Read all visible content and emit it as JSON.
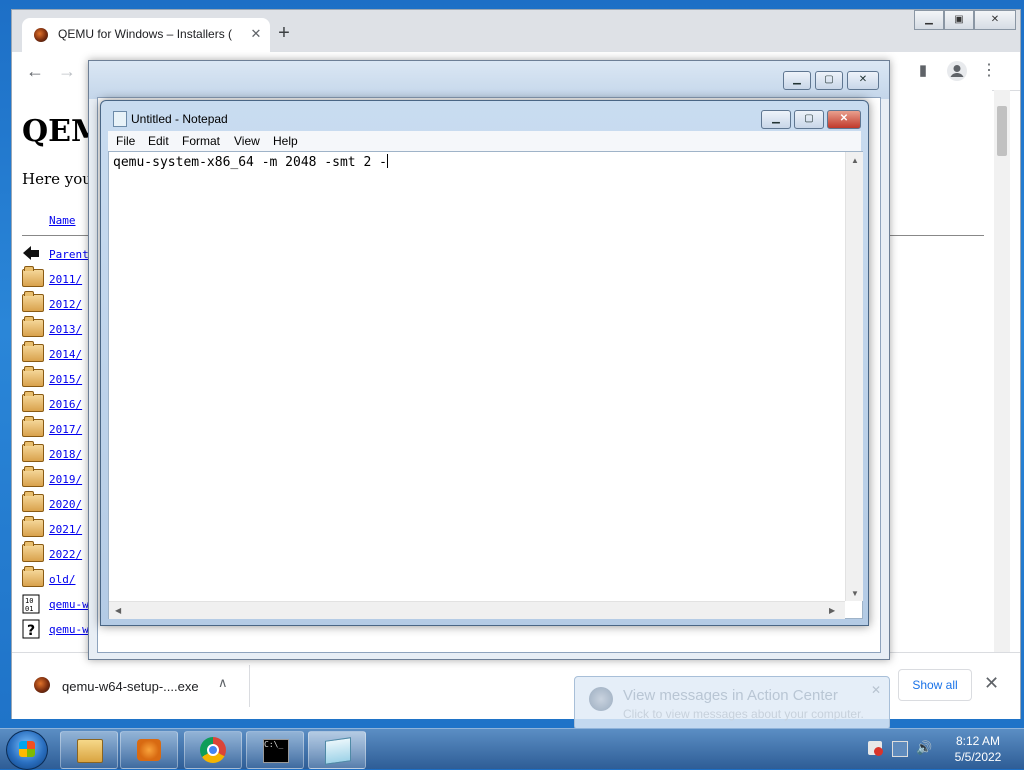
{
  "browser": {
    "tab_title": "QEMU for Windows – Installers (",
    "new_tab": "+",
    "tab_close": "✕",
    "back": "←",
    "forward": "→"
  },
  "page": {
    "heading": "QEM",
    "intro": "Here you g",
    "column_name": "Name",
    "rows": [
      {
        "label": "Parent",
        "icon": "back-arrow-icon"
      },
      {
        "label": "2011/",
        "icon": "folder-icon"
      },
      {
        "label": "2012/",
        "icon": "folder-icon"
      },
      {
        "label": "2013/",
        "icon": "folder-icon"
      },
      {
        "label": "2014/",
        "icon": "folder-icon"
      },
      {
        "label": "2015/",
        "icon": "folder-icon"
      },
      {
        "label": "2016/",
        "icon": "folder-icon"
      },
      {
        "label": "2017/",
        "icon": "folder-icon"
      },
      {
        "label": "2018/",
        "icon": "folder-icon"
      },
      {
        "label": "2019/",
        "icon": "folder-icon"
      },
      {
        "label": "2020/",
        "icon": "folder-icon"
      },
      {
        "label": "2021/",
        "icon": "folder-icon"
      },
      {
        "label": "2022/",
        "icon": "folder-icon"
      },
      {
        "label": "old/",
        "icon": "folder-icon"
      },
      {
        "label": "qemu-w",
        "icon": "binary-file-icon"
      },
      {
        "label": "qemu-w",
        "icon": "unknown-file-icon"
      }
    ]
  },
  "downloads": {
    "file_name": "qemu-w64-setup-....exe",
    "chevron": "∧",
    "show_all": "Show all",
    "close": "✕"
  },
  "notepad": {
    "title": "Untitled - Notepad",
    "menu": [
      "File",
      "Edit",
      "Format",
      "View",
      "Help"
    ],
    "content": "qemu-system-x86_64 -m 2048 -smt 2 -",
    "minimize": "▁",
    "maximize": "▢",
    "close": "✕"
  },
  "notification": {
    "title": "View messages in Action Center",
    "subtitle": "Click to view messages about your computer.",
    "close": "✕"
  },
  "taskbar": {
    "time": "8:12 AM",
    "date": "5/5/2022"
  },
  "colors": {
    "link": "#0000ee",
    "taskbar": "#2e5d96",
    "desktop": "#1e6fc4"
  }
}
